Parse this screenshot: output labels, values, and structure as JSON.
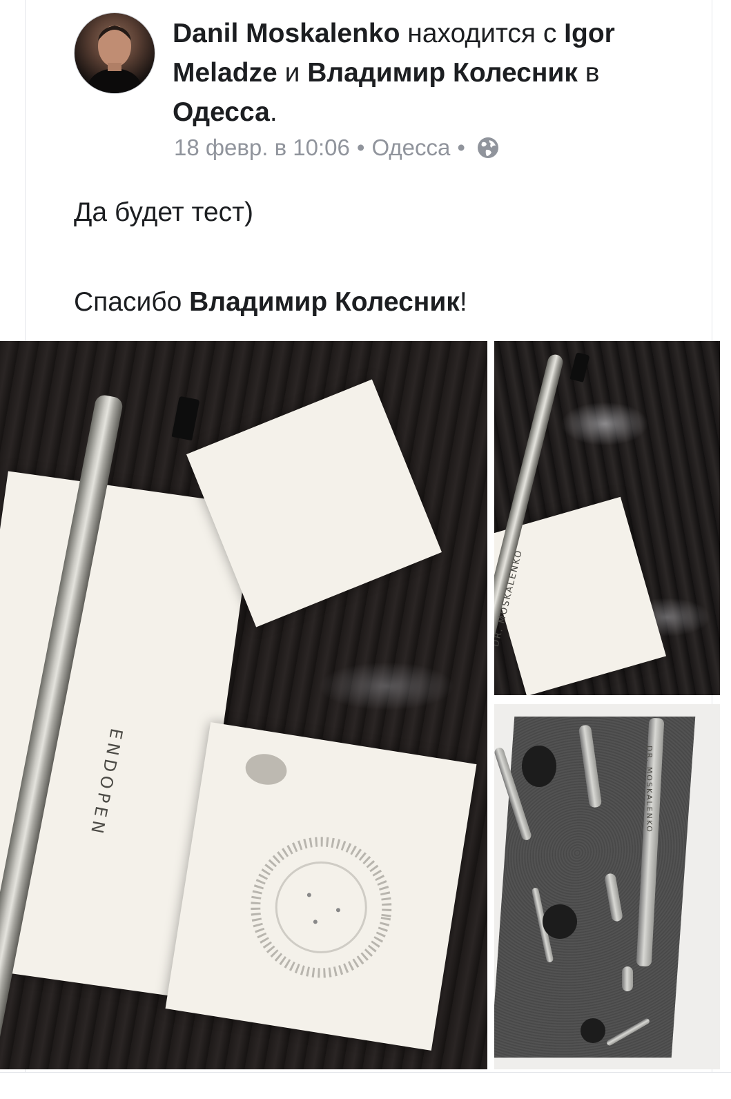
{
  "post": {
    "author": "Danil Moskalenko",
    "with_text": "находится с",
    "tagged_1": "Igor Meladze",
    "and_text": "и",
    "tagged_2": "Владимир Колесник",
    "in_text": "в",
    "location": "Одесса",
    "location_period": ".",
    "timestamp": "18 февр. в 10:06",
    "meta_separator": "•",
    "meta_location": "Одесса",
    "privacy_icon": "globe-icon",
    "text_line_1": "Да будет тест)",
    "text_line_2_prefix": "Спасибо",
    "text_line_2_mention": "Владимир Колесник",
    "text_line_2_suffix": "!"
  },
  "photos": {
    "main_engraving": "ENDOPEN",
    "side_top_engraving": "DR. MOSKALENKO",
    "side_bottom_engraving": "DR. MOSKALENKO"
  },
  "colors": {
    "text_primary": "#1c1e21",
    "text_meta": "#90949c",
    "card_border": "#e4e6ea"
  }
}
